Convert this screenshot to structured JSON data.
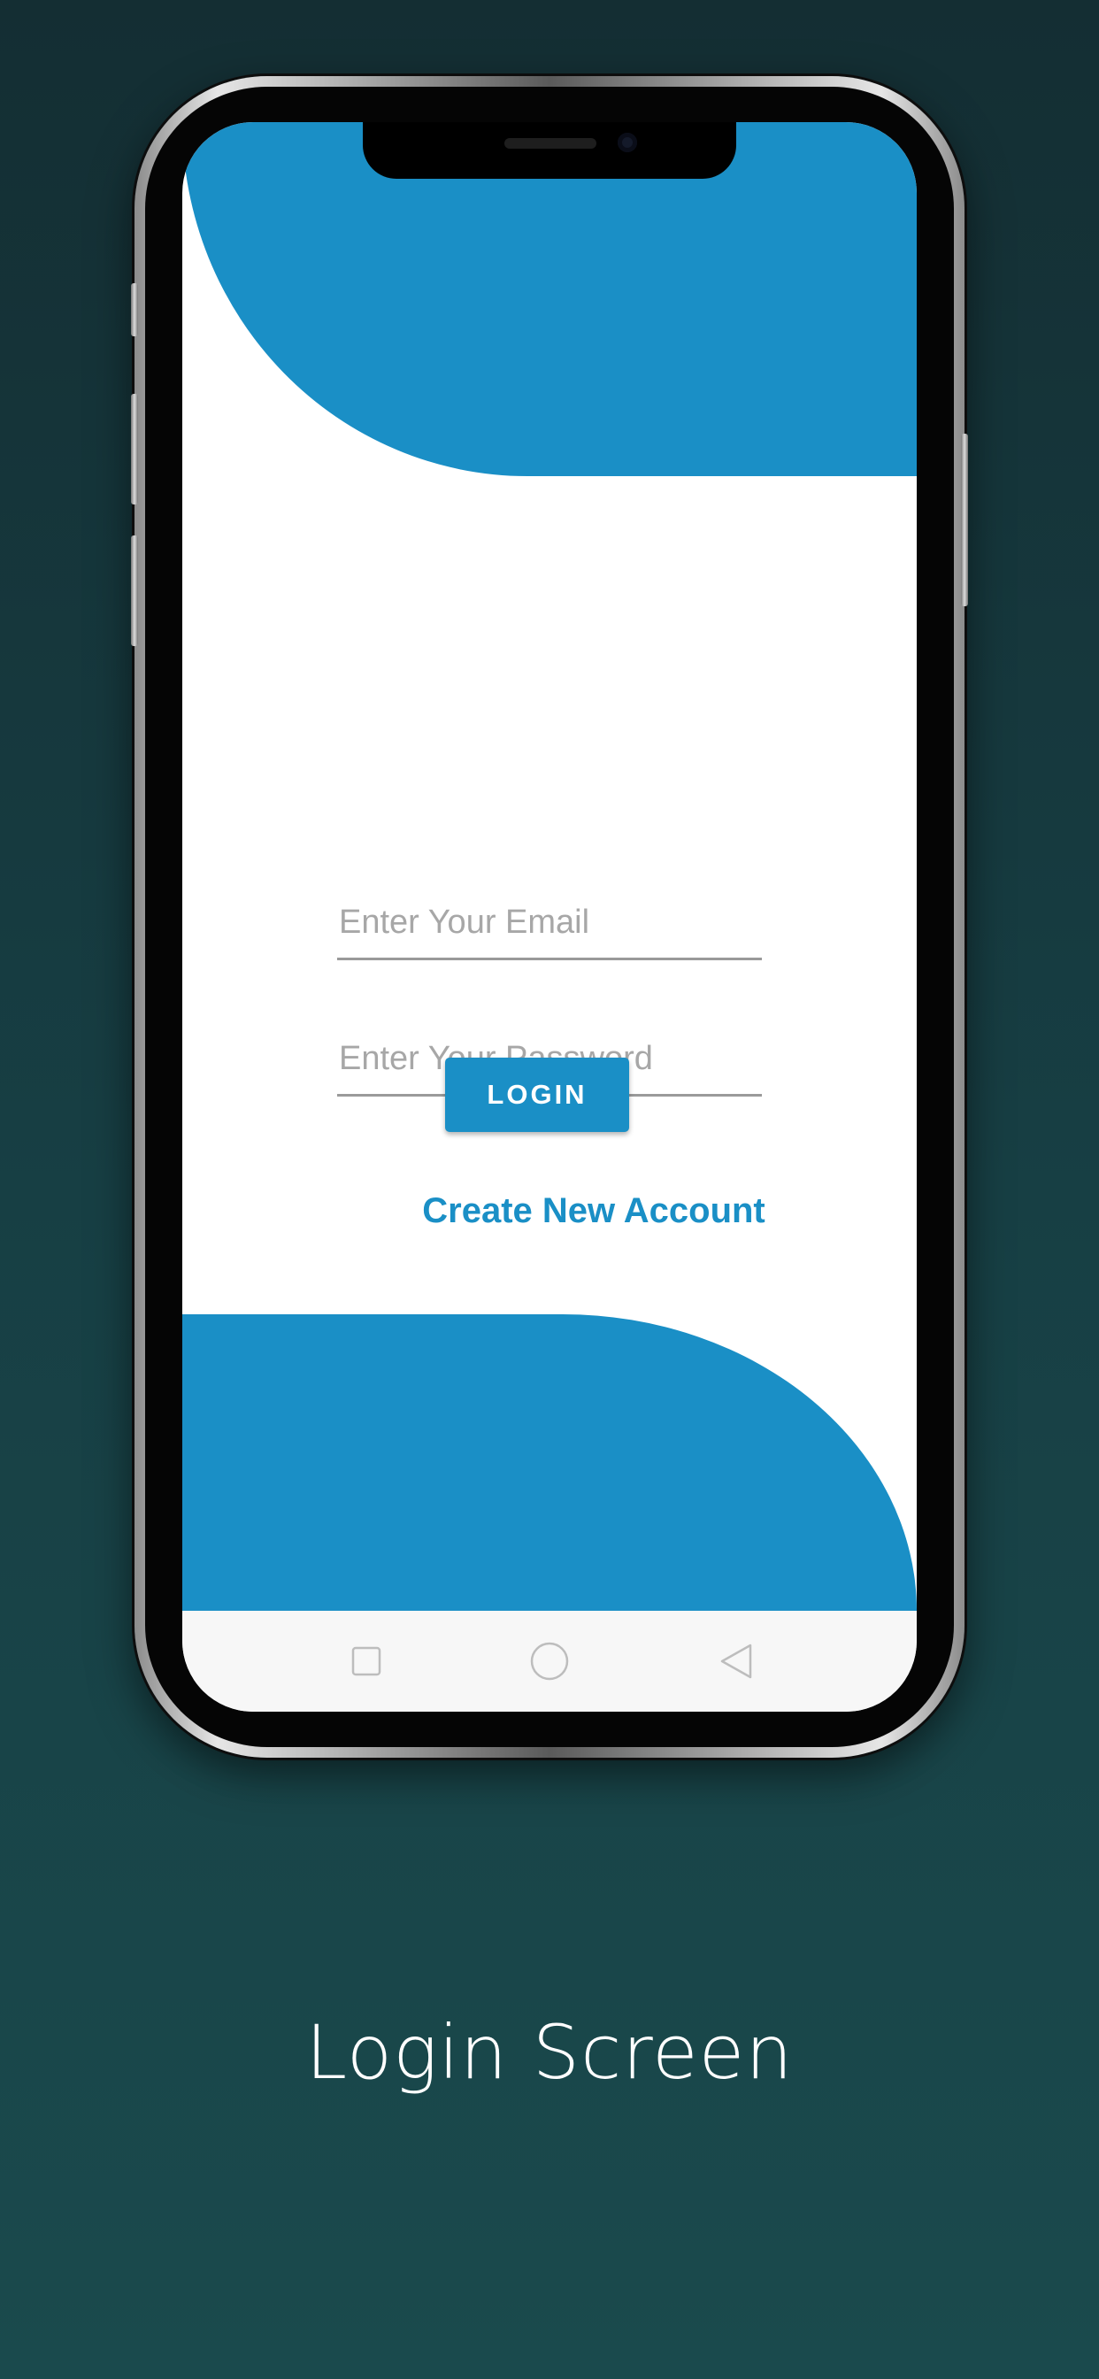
{
  "login_form": {
    "email_placeholder": "Enter Your Email",
    "password_placeholder": "Enter Your Password",
    "login_label": "LOGIN",
    "create_account_label": "Create New Account"
  },
  "nav_bar": {
    "recents_icon": "square-icon",
    "home_icon": "circle-icon",
    "back_icon": "triangle-back-icon"
  },
  "caption": "Login Screen",
  "colors": {
    "accent": "#1a8fc6",
    "background_top": "#142e33",
    "background_bottom": "#1a4a4d"
  }
}
